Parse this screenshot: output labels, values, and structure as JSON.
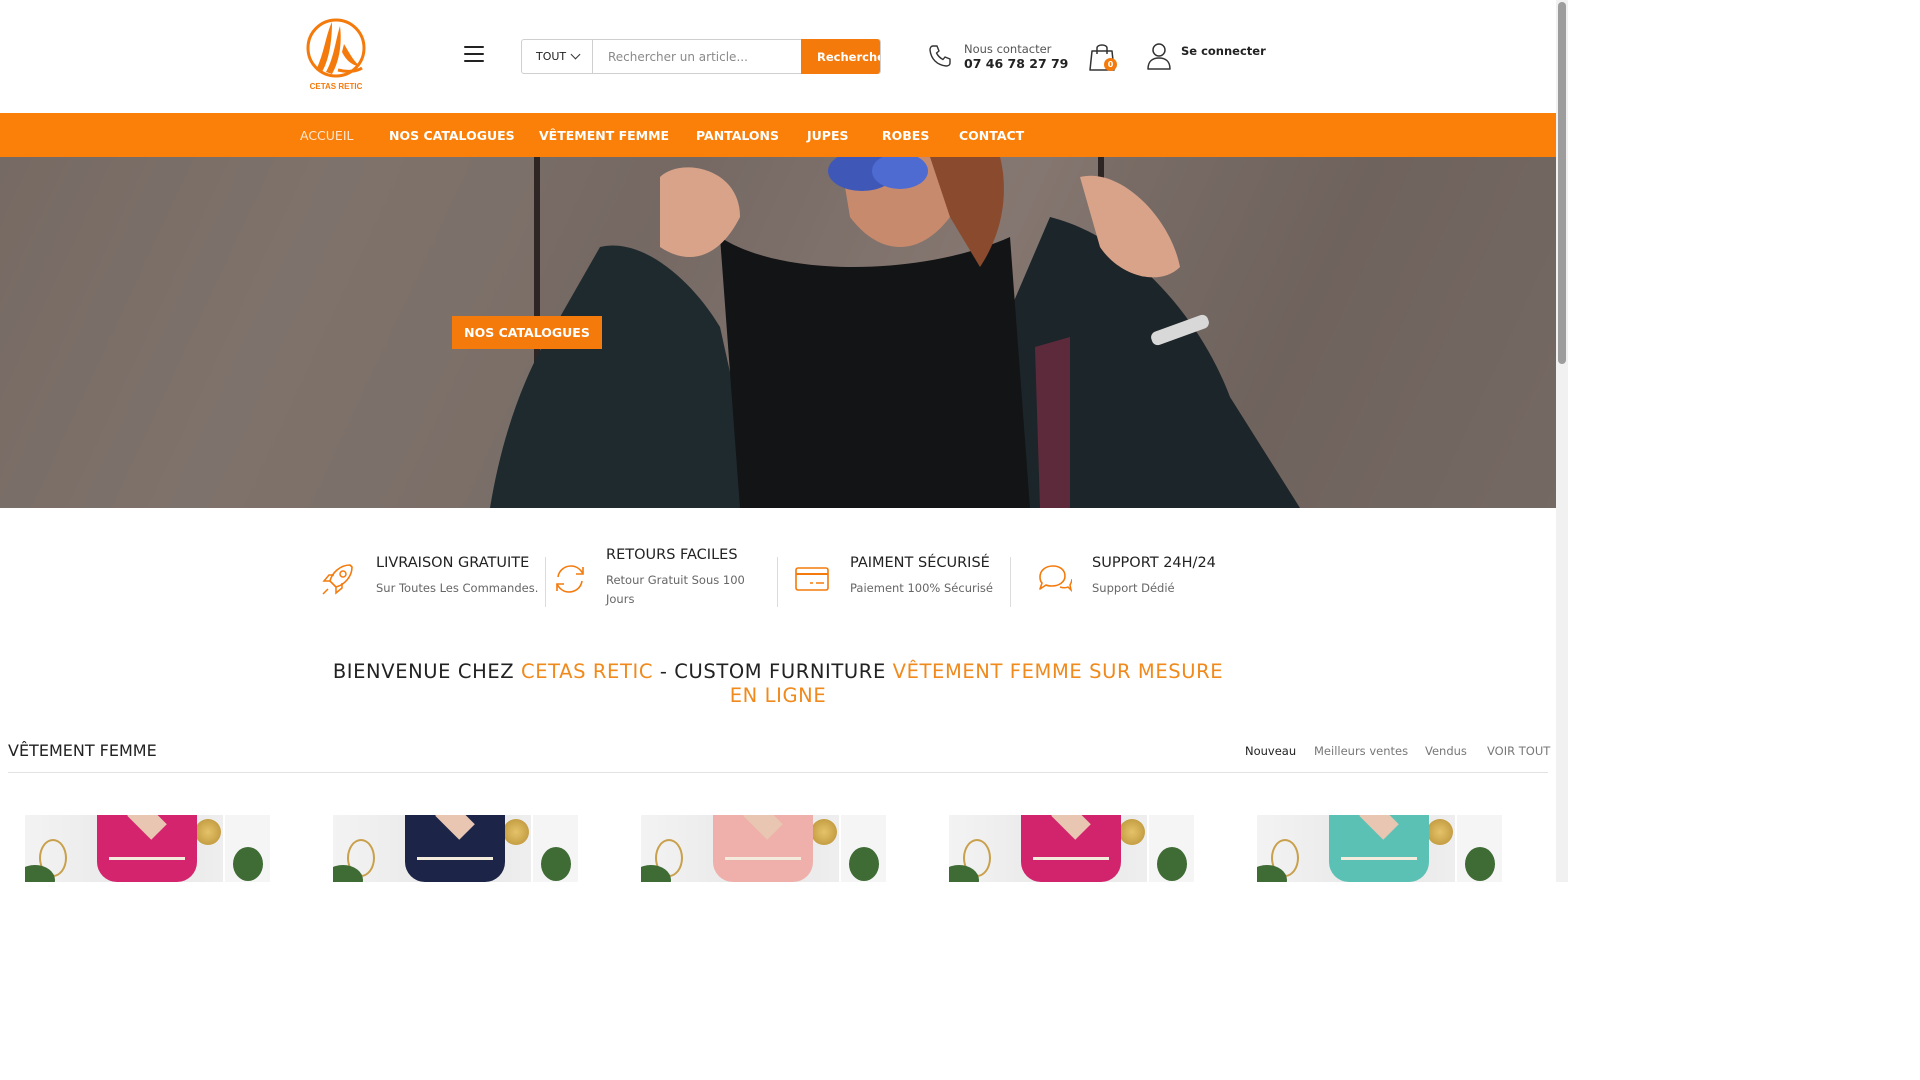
{
  "brand": {
    "logo_text": "CETAS RETIC",
    "accent_color": "#f47a0c"
  },
  "header": {
    "search": {
      "category": "TOUT",
      "placeholder": "Rechercher un article...",
      "button_label": "Rechercher"
    },
    "contact": {
      "label": "Nous contacter",
      "phone": "07 46 78 27 79"
    },
    "cart": {
      "count": "0"
    },
    "account": {
      "label": "Se connecter"
    }
  },
  "nav": {
    "items": [
      {
        "label": "ACCUEIL",
        "active": true
      },
      {
        "label": "NOS CATALOGUES"
      },
      {
        "label": "VÊTEMENT FEMME"
      },
      {
        "label": "PANTALONS"
      },
      {
        "label": "JUPES"
      },
      {
        "label": "ROBES"
      },
      {
        "label": "CONTACT"
      }
    ]
  },
  "hero": {
    "button_label": "NOS CATALOGUES"
  },
  "features": [
    {
      "icon": "rocket-icon",
      "title": "LIVRAISON GRATUITE",
      "desc": "Sur Toutes Les Commandes."
    },
    {
      "icon": "refresh-icon",
      "title": "RETOURS FACILES",
      "desc": "Retour Gratuit Sous 100 Jours"
    },
    {
      "icon": "credit-card-icon",
      "title": "PAIMENT SÉCURISÉ",
      "desc": "Paiement 100% Sécurisé"
    },
    {
      "icon": "chat-bubbles-icon",
      "title": "SUPPORT 24H/24",
      "desc": "Support Dédié"
    }
  ],
  "welcome": {
    "part1": "BIENVENUE CHEZ ",
    "part2": "CETAS RETIC",
    "part3": " - CUSTOM FURNITURE ",
    "part4": "VÊTEMENT FEMME SUR MESURE EN LIGNE"
  },
  "section": {
    "title": "VÊTEMENT FEMME",
    "tabs": [
      {
        "label": "Nouveau",
        "active": true
      },
      {
        "label": "Meilleurs ventes"
      },
      {
        "label": "Vendus"
      },
      {
        "label": "VOIR TOUT"
      }
    ]
  },
  "products": [
    {
      "dress_color": "#d4246e"
    },
    {
      "dress_color": "#1c2447"
    },
    {
      "dress_color": "#efb0ab"
    },
    {
      "dress_color": "#d1246d"
    },
    {
      "dress_color": "#5cc1b5"
    }
  ]
}
